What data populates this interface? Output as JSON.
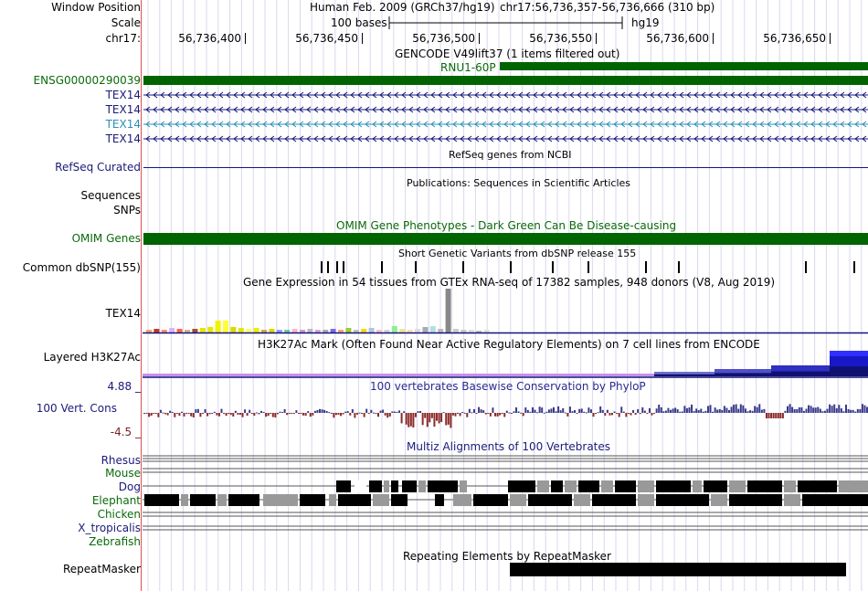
{
  "header": {
    "window_position_label": "Window Position",
    "scale_label": "Scale",
    "chrom_label": "chr17:",
    "assembly": "Human Feb. 2009 (GRCh37/hg19)",
    "position": "chr17:56,736,357-56,736,666 (310 bp)",
    "scale_text": "100 bases",
    "db": "hg19",
    "ruler_ticks": [
      "56,736,400",
      "56,736,450",
      "56,736,500",
      "56,736,550",
      "56,736,600",
      "56,736,650"
    ]
  },
  "tracks": {
    "gencode": {
      "title": "GENCODE V49lift37 (1 items filtered out)",
      "feature_label": "RNU1-60P",
      "gene_id": "ENSG00000290039"
    },
    "tex14": [
      "TEX14",
      "TEX14",
      "TEX14",
      "TEX14"
    ],
    "refseq": {
      "title": "RefSeq genes from NCBI",
      "label": "RefSeq Curated"
    },
    "publications": {
      "title": "Publications: Sequences in Scientific Articles",
      "label": "Sequences"
    },
    "snps": {
      "label": "SNPs"
    },
    "omim": {
      "title": "OMIM Gene Phenotypes - Dark Green Can Be Disease-causing",
      "label": "OMIM Genes"
    },
    "dbsnp": {
      "title": "Short Genetic Variants from dbSNP release 155",
      "label": "Common dbSNP(155)"
    },
    "gtex": {
      "title": "Gene Expression in 54 tissues from GTEx RNA-seq of 17382 samples, 948 donors (V8, Aug 2019)",
      "label": "TEX14"
    },
    "h3k27ac": {
      "title": "H3K27Ac Mark (Often Found Near Active Regulatory Elements) on 7 cell lines from ENCODE",
      "label": "Layered H3K27Ac"
    },
    "phylop": {
      "title": "100 vertebrates Basewise Conservation by PhyloP",
      "label": "100 Vert. Cons",
      "max": "4.88 _",
      "min": "-4.5 _"
    },
    "multiz": {
      "title": "Multiz Alignments of 100 Vertebrates",
      "species": [
        "Rhesus",
        "Mouse",
        "Dog",
        "Elephant",
        "Chicken",
        "X_tropicalis",
        "Zebrafish"
      ]
    },
    "repeatmasker": {
      "title": "Repeating Elements by RepeatMasker",
      "label": "RepeatMasker"
    }
  },
  "colors": {
    "gene_green": "#006400",
    "navy": "#14147a",
    "phylop_pos": "#3a3a8c",
    "phylop_neg": "#8c2a2a",
    "h3k27ac_dark": "#1a1aa0"
  }
}
